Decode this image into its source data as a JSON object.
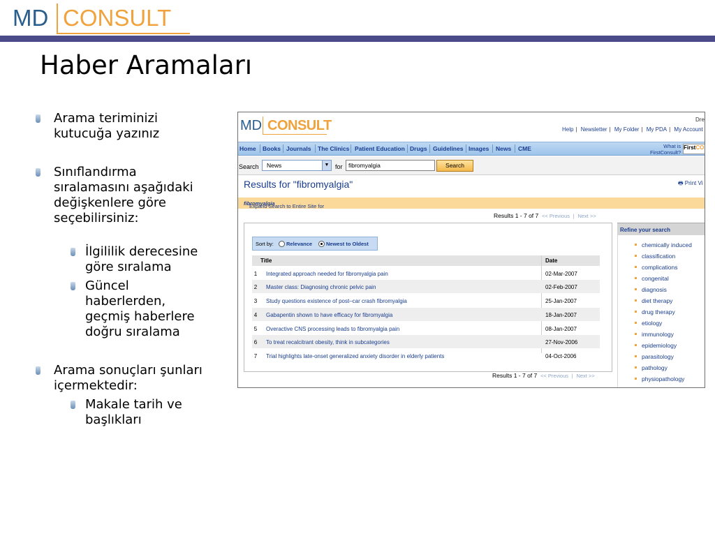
{
  "logo": {
    "left": "MD",
    "right": "CONSULT"
  },
  "slide": {
    "title": "Haber Aramaları",
    "bullets": [
      {
        "text_lines": [
          "Arama teriminizi",
          "kutucuğa yazınız"
        ]
      },
      {
        "text_lines": [
          "Sınıflandırma",
          "sıralamasını aşağıdaki",
          "değişkenlere göre",
          "seçebilirsiniz:"
        ]
      },
      {
        "text_lines": [
          "İlgililik derecesine",
          "göre sıralama"
        ]
      },
      {
        "text_lines": [
          "Güncel",
          "haberlerden,",
          "geçmiş haberlere",
          "doğru sıralama"
        ]
      },
      {
        "text_lines": [
          "Arama sonuçları şunları",
          "içermektedir:"
        ]
      },
      {
        "text_lines": [
          "Makale tarih ve",
          "başlıkları"
        ]
      }
    ]
  },
  "screenshot": {
    "logo": {
      "left": "MD",
      "right": "CONSULT"
    },
    "top_right_text": "Dre",
    "top_links": [
      "Help",
      "Newsletter",
      "My Folder",
      "My PDA",
      "My Account",
      "L"
    ],
    "nav": [
      "Home",
      "Books",
      "Journals",
      "The Clinics",
      "Patient Education",
      "Drugs",
      "Guidelines",
      "Images",
      "News",
      "CME"
    ],
    "what_is": {
      "line1": "What is",
      "line2": "FirstConsult?"
    },
    "first_consult_badge": {
      "a": "First",
      "b": "CO"
    },
    "search": {
      "label": "Search",
      "selected": "News",
      "for_label": "for",
      "term": "fibromyalgia",
      "button": "Search"
    },
    "results_title": "Results for \"fibromyalgia\"",
    "print_view": "Print Vi",
    "expand": {
      "prefix": "Expand Search to Entire Site for",
      "term": "fibromyalgia"
    },
    "pager": {
      "text": "Results 1 - 7 of 7",
      "prev": "<< Previous",
      "sep": "|",
      "next": "Next >>"
    },
    "sort": {
      "label": "Sort by:",
      "opt1": "Relevance",
      "opt2": "Newest to Oldest"
    },
    "table": {
      "headers": {
        "title": "Title",
        "date": "Date"
      },
      "rows": [
        {
          "n": "1",
          "title": "Integrated approach needed for fibromyalgia pain",
          "date": "02-Mar-2007"
        },
        {
          "n": "2",
          "title": "Master class: Diagnosing chronic pelvic pain",
          "date": "02-Feb-2007"
        },
        {
          "n": "3",
          "title": "Study questions existence of post–car crash fibromyalgia",
          "date": "25-Jan-2007"
        },
        {
          "n": "4",
          "title": "Gabapentin shown to have efficacy for fibromyalgia",
          "date": "18-Jan-2007"
        },
        {
          "n": "5",
          "title": "Overactive CNS processing leads to fibromyalgia pain",
          "date": "08-Jan-2007"
        },
        {
          "n": "6",
          "title": "To treat recalcitrant obesity, think in subcategories",
          "date": "27-Nov-2006"
        },
        {
          "n": "7",
          "title": "Trial highlights late-onset generalized anxiety disorder in elderly patients",
          "date": "04-Oct-2006"
        }
      ]
    },
    "refine": {
      "title": "Refine your search",
      "items": [
        "chemically induced",
        "classification",
        "complications",
        "congenital",
        "diagnosis",
        "diet therapy",
        "drug therapy",
        "etiology",
        "immunology",
        "epidemiology",
        "parasitology",
        "pathology",
        "physiopathology"
      ]
    }
  }
}
